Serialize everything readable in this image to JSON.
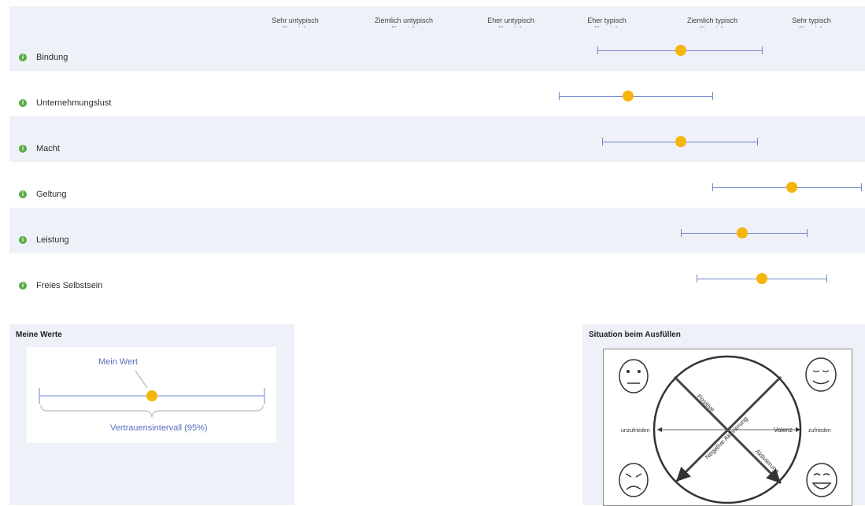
{
  "scale": {
    "columns": [
      "Sehr untypisch\nfür mich",
      "Ziemlich untypisch\nfür mich",
      "Eher untypisch\nfür mich",
      "Eher typisch\nfür mich",
      "Ziemlich typisch\nfür mich",
      "Sehr typisch\nfür mich"
    ]
  },
  "rows": [
    {
      "label": "Bindung",
      "value": 4.7,
      "ci_low": 3.9,
      "ci_high": 5.5,
      "shaded": true
    },
    {
      "label": "Unternehmungslust",
      "value": 4.2,
      "ci_low": 3.5,
      "ci_high": 5.0,
      "shaded": false
    },
    {
      "label": "Macht",
      "value": 4.7,
      "ci_low": 3.95,
      "ci_high": 5.45,
      "shaded": true
    },
    {
      "label": "Geltung",
      "value": 5.8,
      "ci_low": 5.0,
      "ci_high": 6.5,
      "shaded": false
    },
    {
      "label": "Leistung",
      "value": 5.3,
      "ci_low": 4.7,
      "ci_high": 5.95,
      "shaded": true
    },
    {
      "label": "Freies Selbstsein",
      "value": 5.5,
      "ci_low": 4.85,
      "ci_high": 6.15,
      "shaded": false
    }
  ],
  "legend": {
    "title": "Meine Werte",
    "value_label": "Mein Wert",
    "interval_label": "Vertrauensintervall (95%)"
  },
  "situation": {
    "title": "Situation beim Ausfüllen",
    "left_label": "unzufrieden",
    "right_label": "zufrieden",
    "valence_label": "Valenz",
    "positive_label": "Positive",
    "negative_label": "Negative Aktivierung",
    "activation_label": "Aktivierung"
  },
  "colors": {
    "dot": "#f6b50b",
    "line": "#6f87c9",
    "shade": "#eef1f7",
    "info": "#5aac44"
  }
}
